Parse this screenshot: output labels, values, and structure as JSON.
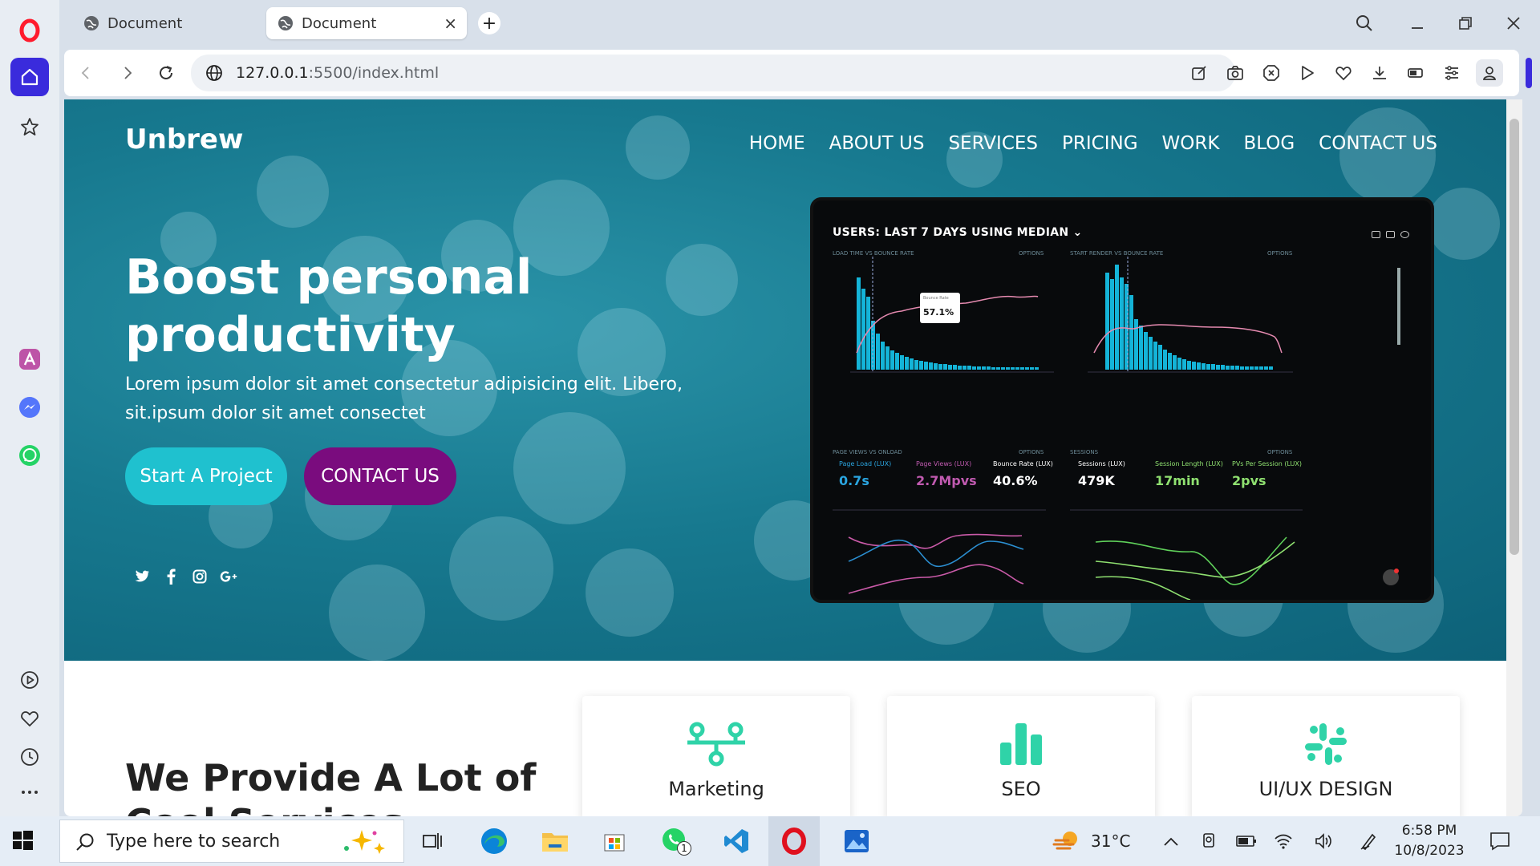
{
  "browser": {
    "tabs": [
      {
        "title": "Document",
        "active": false
      },
      {
        "title": "Document",
        "active": true
      }
    ],
    "new_tab_symbol": "+",
    "close_tab_symbol": "×",
    "url_host": "127.0.0.1",
    "url_rest": ":5500/index.html",
    "accent_color": "#3a2bdc"
  },
  "page": {
    "brand": "Unbrew",
    "nav": [
      "HOME",
      "ABOUT US",
      "SERVICES",
      "PRICING",
      "WORK",
      "BLOG",
      "CONTACT US"
    ],
    "hero_title": "Boost personal productivity",
    "hero_text": "Lorem ipsum dolor sit amet consectetur adipisicing elit. Libero, sit.ipsum dolor sit amet consectet",
    "primary_button": "Start A Project",
    "secondary_button": "CONTACT US",
    "social": [
      "twitter-icon",
      "facebook-icon",
      "instagram-icon",
      "google-plus-icon"
    ],
    "services_title": "We Provide A Lot of",
    "services_title_cut": "Cool Services",
    "cards": [
      "Marketing",
      "SEO",
      "UI/UX DESIGN"
    ],
    "colors": {
      "primary_button": "#1fc1cf",
      "secondary_button": "#7a0c7e",
      "card_icon": "#2fd3a8"
    }
  },
  "dashboard": {
    "title": "USERS: LAST 7 DAYS USING MEDIAN",
    "panel1": "LOAD TIME VS BOUNCE RATE",
    "panel2": "START RENDER VS BOUNCE RATE",
    "panel3": "PAGE VIEWS VS ONLOAD",
    "panel4": "SESSIONS",
    "options": "OPTIONS",
    "tooltip_label": "Bounce Rate",
    "tooltip_value": "57.1%",
    "metrics": [
      {
        "label": "Page Load (LUX)",
        "value": "0.7s",
        "color": "#2aa5e0"
      },
      {
        "label": "Page Views (LUX)",
        "value": "2.7Mpvs",
        "color": "#c05ab0"
      },
      {
        "label": "Bounce Rate (LUX)",
        "value": "40.6%",
        "color": "#ffffff"
      },
      {
        "label": "Sessions (LUX)",
        "value": "479K",
        "color": "#ffffff"
      },
      {
        "label": "Session Length (LUX)",
        "value": "17min",
        "color": "#8fe070"
      },
      {
        "label": "PVs Per Session (LUX)",
        "value": "2pvs",
        "color": "#8fe070"
      }
    ]
  },
  "taskbar": {
    "search_placeholder": "Type here to search",
    "weather": "31°C",
    "time": "6:58 PM",
    "date": "10/8/2023",
    "whatsapp_badge": "1"
  }
}
